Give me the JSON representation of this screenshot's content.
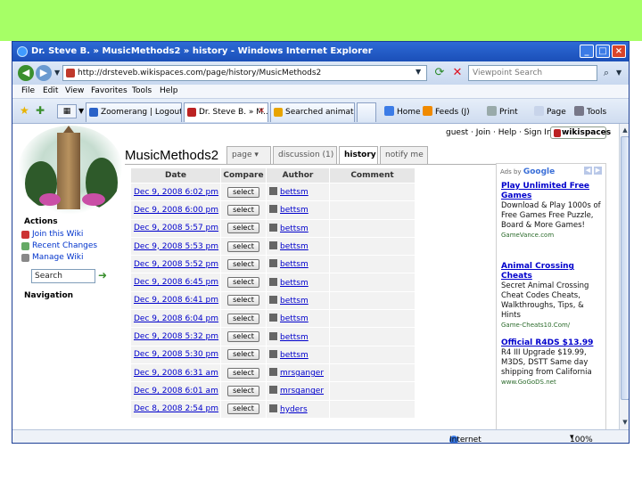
{
  "window": {
    "title": "Dr. Steve B. » MusicMethods2 » history - Windows Internet Explorer",
    "min_icon": "minimize-icon",
    "max_icon": "maximize-icon",
    "close_icon": "close-icon"
  },
  "address": {
    "url": "http://drsteveb.wikispaces.com/page/history/MusicMethods2",
    "search_placeholder": "Viewpoint Search"
  },
  "menu": [
    "File",
    "Edit",
    "View",
    "Favorites",
    "Tools",
    "Help"
  ],
  "tabs": [
    {
      "label": "Zoomerang | Logout"
    },
    {
      "label": "Dr. Steve B. » M..."
    },
    {
      "label": "Searched animatio"
    }
  ],
  "commands": {
    "home": "Home",
    "feeds": "Feeds (J)",
    "print": "Print",
    "page": "Page",
    "tools": "Tools"
  },
  "wiki": {
    "top_links": "guest · Join · Help · Sign In",
    "badge": "wikispaces",
    "title": "MusicMethods2",
    "tabs": [
      "page",
      "discussion (1)",
      "history",
      "notify me"
    ],
    "sidebar": {
      "actions_heading": "Actions",
      "links": [
        "Join this Wiki",
        "Recent Changes",
        "Manage Wiki"
      ],
      "search_value": "Search",
      "navigation_heading": "Navigation"
    },
    "table": {
      "headers": [
        "Date",
        "Compare",
        "Author",
        "Comment"
      ],
      "select_label": "select",
      "rows": [
        {
          "date": "Dec 9, 2008 6:02 pm",
          "author": "bettsm"
        },
        {
          "date": "Dec 9, 2008 6:00 pm",
          "author": "bettsm"
        },
        {
          "date": "Dec 9, 2008 5:57 pm",
          "author": "bettsm"
        },
        {
          "date": "Dec 9, 2008 5:53 pm",
          "author": "bettsm"
        },
        {
          "date": "Dec 9, 2008 5:52 pm",
          "author": "bettsm"
        },
        {
          "date": "Dec 9, 2008 6:45 pm",
          "author": "bettsm"
        },
        {
          "date": "Dec 9, 2008 6:41 pm",
          "author": "bettsm"
        },
        {
          "date": "Dec 9, 2008 6:04 pm",
          "author": "bettsm"
        },
        {
          "date": "Dec 9, 2008 5:32 pm",
          "author": "bettsm"
        },
        {
          "date": "Dec 9, 2008 5:30 pm",
          "author": "bettsm"
        },
        {
          "date": "Dec 9, 2008 6:31 am",
          "author": "mrsganger"
        },
        {
          "date": "Dec 9, 2008 6:01 am",
          "author": "mrsganger"
        },
        {
          "date": "Dec 8, 2008 2:54 pm",
          "author": "hyders"
        }
      ]
    },
    "ads": {
      "ads_by": "Ads by",
      "google": "Google",
      "items": [
        {
          "headline": "Play Unlimited Free Games",
          "body": "Download & Play 1000s of Free Games Free Puzzle, Board & More Games!",
          "url": "GameVance.com"
        },
        {
          "headline": "Animal Crossing Cheats",
          "body": "Secret Animal Crossing Cheat Codes Cheats, Walkthroughs, Tips, & Hints",
          "url": "Game-Cheats10.Com/"
        },
        {
          "headline": "Official R4DS $13.99",
          "body": "R4 III Upgrade $19.99, M3DS, DSTT Same day shipping from California",
          "url": "www.GoGoDS.net"
        }
      ]
    }
  },
  "status": {
    "zone": "Internet",
    "zoom": "100%"
  }
}
